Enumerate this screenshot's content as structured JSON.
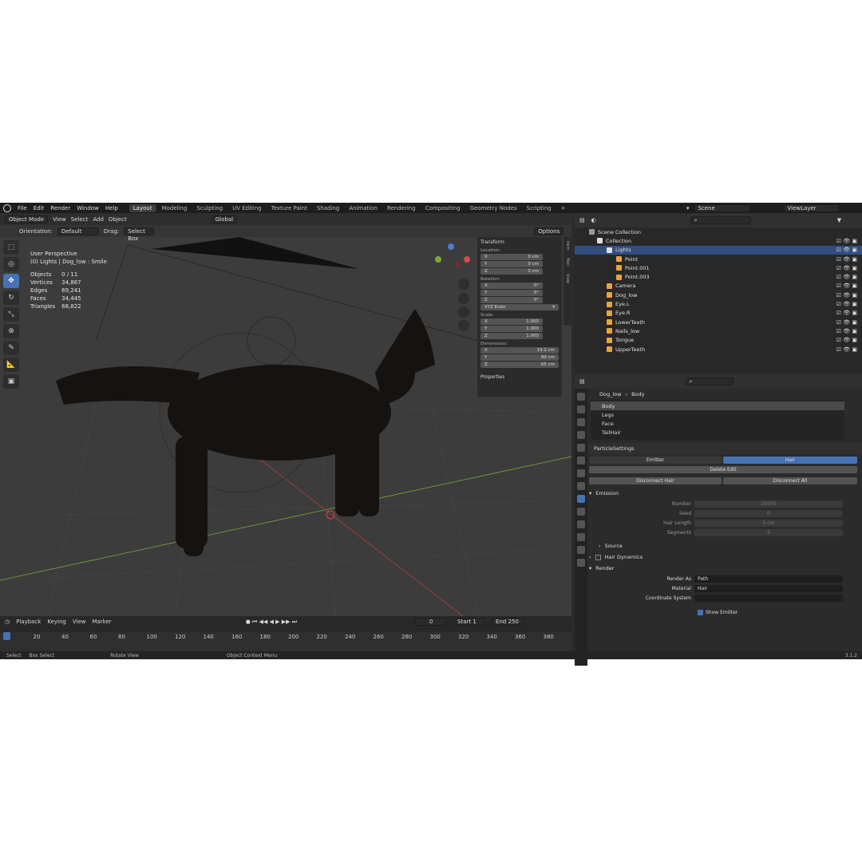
{
  "menu": {
    "file": "File",
    "edit": "Edit",
    "render": "Render",
    "window": "Window",
    "help": "Help"
  },
  "workspaces": [
    "Layout",
    "Modeling",
    "Sculpting",
    "UV Editing",
    "Texture Paint",
    "Shading",
    "Animation",
    "Rendering",
    "Compositing",
    "Geometry Nodes",
    "Scripting",
    "+"
  ],
  "scene": {
    "name": "Scene",
    "view_layer": "ViewLayer"
  },
  "viewport": {
    "mode": "Object Mode",
    "view": "View",
    "select": "Select",
    "add": "Add",
    "object": "Object",
    "transform_orient": "Global",
    "orientation_label": "Orientation:",
    "orientation_value": "Default",
    "drag_label": "Drag:",
    "drag_value": "Select Box",
    "options": "Options",
    "view_name": "User Perspective",
    "context": "(0) Lights | Dog_low : Smile"
  },
  "stats": [
    [
      "Objects",
      "0 / 11"
    ],
    [
      "Vertices",
      "34,867"
    ],
    [
      "Edges",
      "69,241"
    ],
    [
      "Faces",
      "34,445"
    ],
    [
      "Triangles",
      "68,822"
    ]
  ],
  "npanel": {
    "title": "Transform",
    "location_label": "Location:",
    "location": [
      [
        "X",
        "0 cm"
      ],
      [
        "Y",
        "0 cm"
      ],
      [
        "Z",
        "0 cm"
      ]
    ],
    "rotation_label": "Rotation:",
    "rotation": [
      [
        "X",
        "0°"
      ],
      [
        "Y",
        "0°"
      ],
      [
        "Z",
        "0°"
      ]
    ],
    "rotation_mode": "XYZ Euler",
    "scale_label": "Scale:",
    "scale": [
      [
        "X",
        "1.000"
      ],
      [
        "Y",
        "1.000"
      ],
      [
        "Z",
        "1.000"
      ]
    ],
    "dimensions_label": "Dimensions:",
    "dimensions": [
      [
        "X",
        "19.2 cm"
      ],
      [
        "Y",
        "99 cm"
      ],
      [
        "Z",
        "65 cm"
      ]
    ],
    "properties": "Properties",
    "tabs": [
      "Item",
      "Tool",
      "View"
    ]
  },
  "timeline": {
    "playback": "Playback",
    "keying": "Keying",
    "view": "View",
    "marker": "Marker",
    "current": "0",
    "start_label": "Start",
    "start": "1",
    "end_label": "End",
    "end": "250",
    "ticks": [
      "0",
      "20",
      "40",
      "60",
      "80",
      "100",
      "120",
      "140",
      "160",
      "180",
      "200",
      "220",
      "240",
      "260",
      "280",
      "300",
      "320",
      "340",
      "360",
      "380"
    ]
  },
  "status": {
    "select": "Select",
    "box_select": "Box Select",
    "rotate": "Rotate View",
    "context_menu": "Object Context Menu",
    "version": "3.1.2"
  },
  "outliner": {
    "scene_collection": "Scene Collection",
    "items": [
      {
        "label": "Collection",
        "indent": 1,
        "color": "#ddd"
      },
      {
        "label": "Lights",
        "indent": 2,
        "color": "#ddd",
        "selected": true
      },
      {
        "label": "Point",
        "indent": 3,
        "color": "#e8a33c"
      },
      {
        "label": "Point.001",
        "indent": 3,
        "color": "#e8a33c"
      },
      {
        "label": "Point.003",
        "indent": 3,
        "color": "#e8a33c"
      },
      {
        "label": "Camera",
        "indent": 2,
        "color": "#e8a33c"
      },
      {
        "label": "Dog_low",
        "indent": 2,
        "color": "#e8a33c"
      },
      {
        "label": "Eye.L",
        "indent": 2,
        "color": "#e8a33c"
      },
      {
        "label": "Eye.R",
        "indent": 2,
        "color": "#e8a33c"
      },
      {
        "label": "LowerTeeth",
        "indent": 2,
        "color": "#e8a33c"
      },
      {
        "label": "Nails_low",
        "indent": 2,
        "color": "#e8a33c"
      },
      {
        "label": "Tongue",
        "indent": 2,
        "color": "#e8a33c"
      },
      {
        "label": "UpperTeeth",
        "indent": 2,
        "color": "#e8a33c"
      }
    ]
  },
  "properties": {
    "breadcrumb_obj": "Dog_low",
    "breadcrumb_sys": "Body",
    "systems": [
      "Body",
      "Legs",
      "Face",
      "TailHair"
    ],
    "settings": "ParticleSettings",
    "emitter": "Emitter",
    "hair": "Hair",
    "delete_edit": "Delete Edit",
    "disconnect_hair": "Disconnect Hair",
    "disconnect_all": "Disconnect All",
    "emission": "Emission",
    "number_label": "Number",
    "number": "25000",
    "seed_label": "Seed",
    "seed": "0",
    "hair_length_label": "Hair Length",
    "hair_length": "5 cm",
    "segments_label": "Segments",
    "segments": "5",
    "source": "Source",
    "hair_dynamics": "Hair Dynamics",
    "render": "Render",
    "render_as_label": "Render As",
    "render_as": "Path",
    "material_label": "Material",
    "material": "Hair",
    "coord_label": "Coordinate System",
    "show_emitter": "Show Emitter"
  },
  "colors": {
    "accent": "#4772b3",
    "x_axis": "#c23b3b",
    "y_axis": "#7ca83a"
  }
}
